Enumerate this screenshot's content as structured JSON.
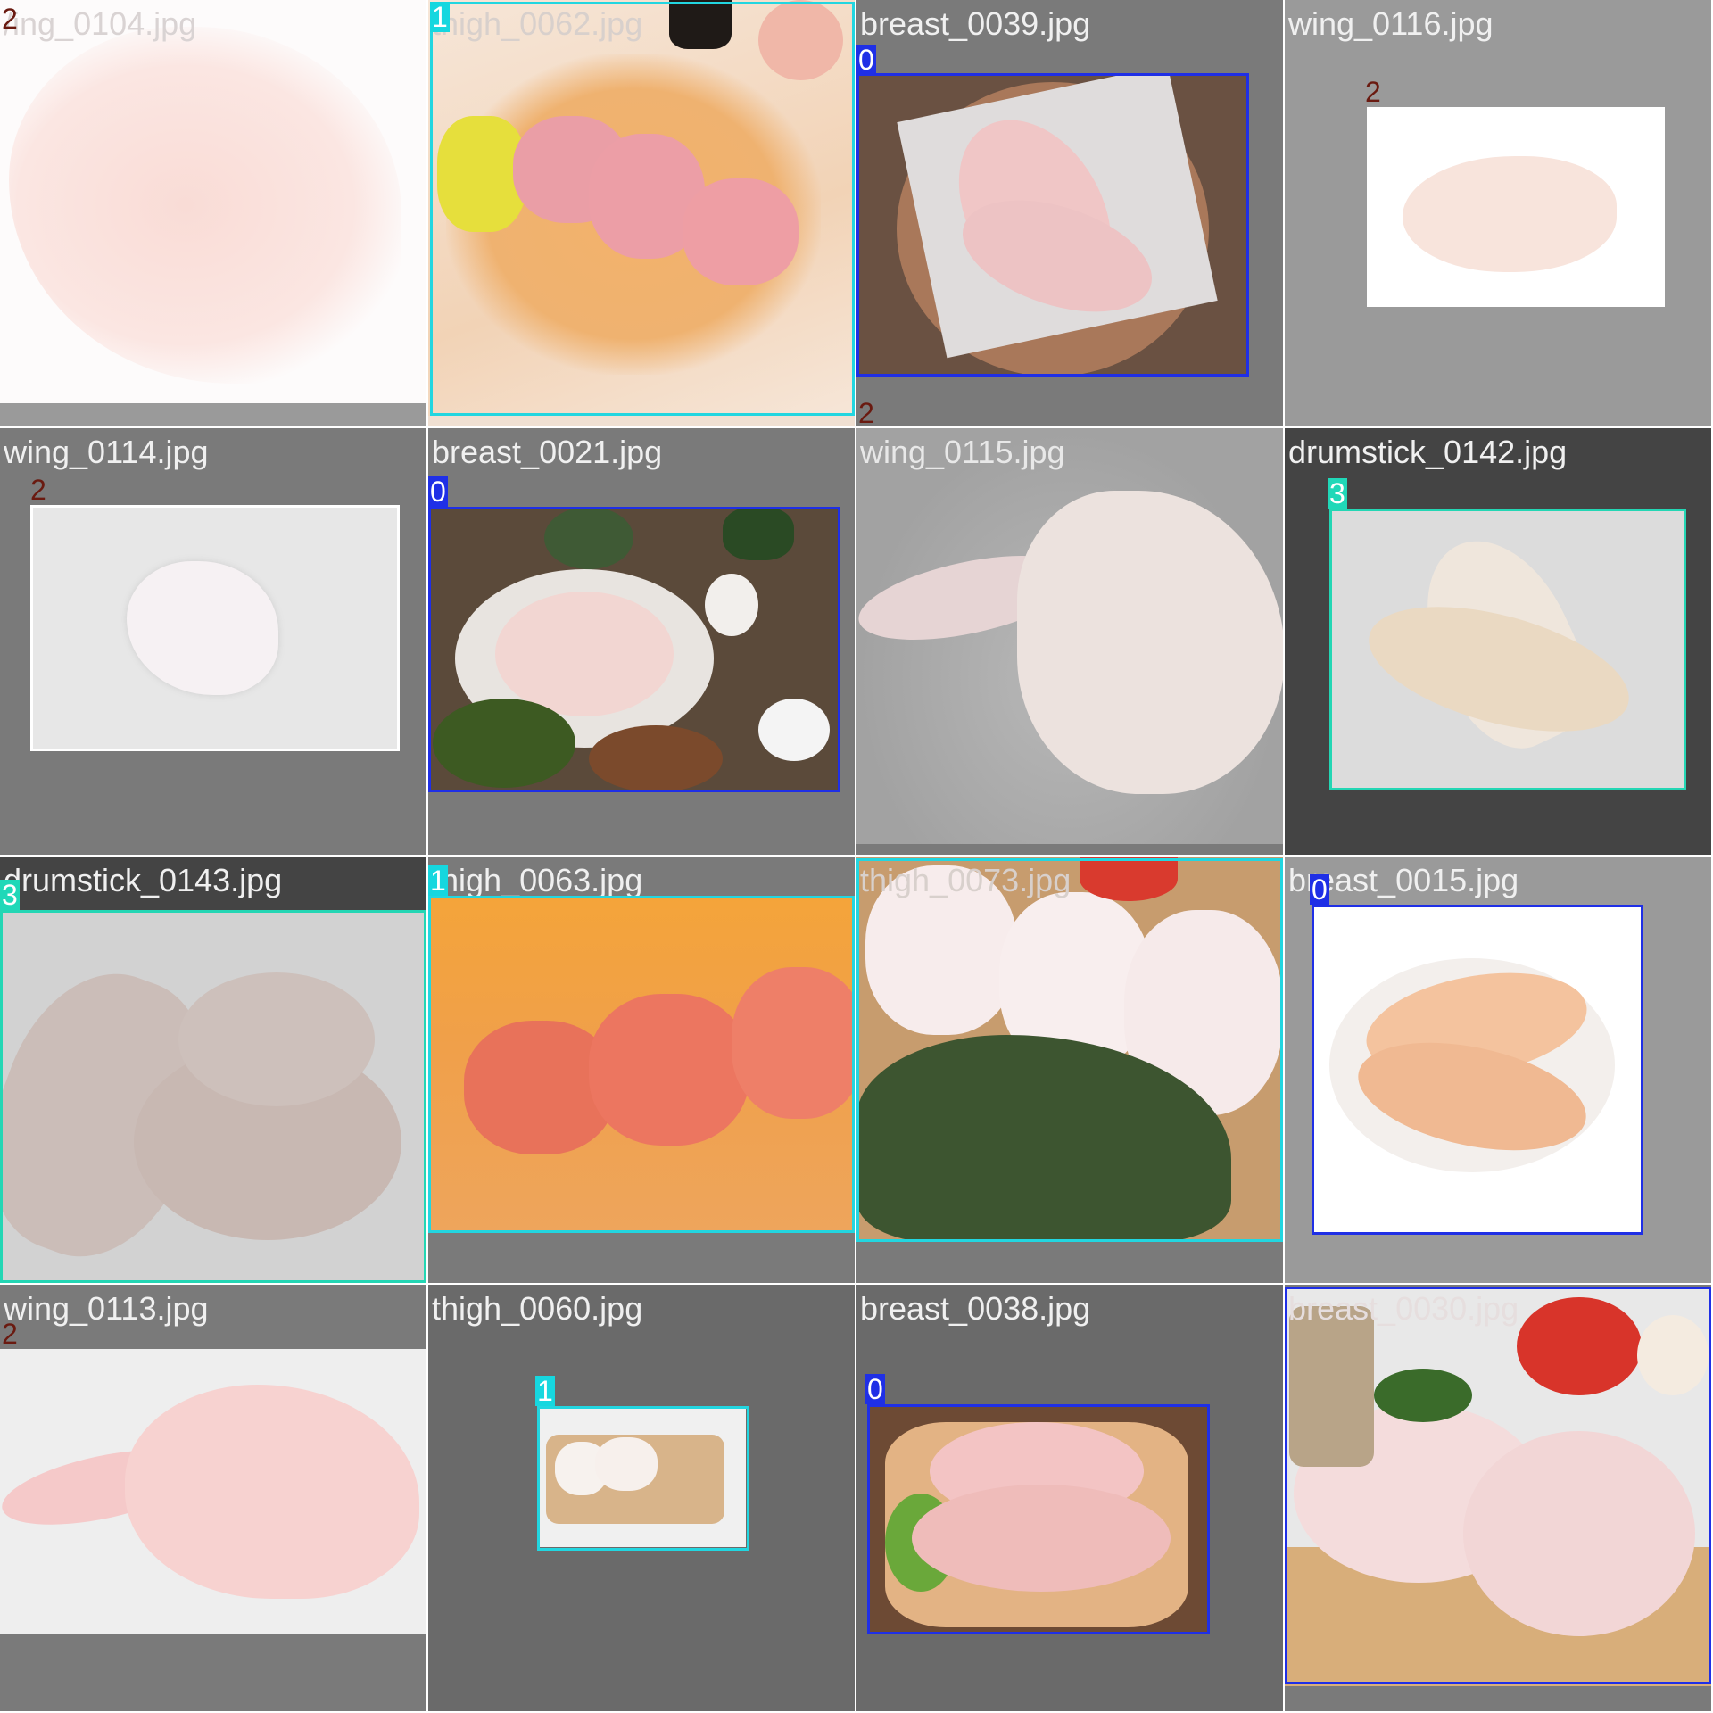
{
  "tiles": [
    {
      "filename": "wing_0104.jpg",
      "display_filename": "/ing_0104.jpg",
      "labels": [
        "2"
      ],
      "box_class": "none"
    },
    {
      "filename": "thigh_0062.jpg",
      "display_filename": "thigh_0062.jpg",
      "labels": [
        "1"
      ],
      "box_class": "1"
    },
    {
      "filename": "breast_0039.jpg",
      "display_filename": "breast_0039.jpg",
      "labels": [
        "0",
        "2"
      ],
      "box_class": "0"
    },
    {
      "filename": "wing_0116.jpg",
      "display_filename": "wing_0116.jpg",
      "labels": [
        "2"
      ],
      "box_class": "2"
    },
    {
      "filename": "wing_0114.jpg",
      "display_filename": "wing_0114.jpg",
      "labels": [
        "2"
      ],
      "box_class": "2"
    },
    {
      "filename": "breast_0021.jpg",
      "display_filename": "breast_0021.jpg",
      "labels": [
        "0"
      ],
      "box_class": "0"
    },
    {
      "filename": "wing_0115.jpg",
      "display_filename": "wing_0115.jpg",
      "labels": [],
      "box_class": "none"
    },
    {
      "filename": "drumstick_0142.jpg",
      "display_filename": "drumstick_0142.jpg",
      "labels": [
        "3"
      ],
      "box_class": "3"
    },
    {
      "filename": "drumstick_0143.jpg",
      "display_filename": "drumstick_0143.jpg",
      "labels": [
        "3"
      ],
      "box_class": "3"
    },
    {
      "filename": "thigh_0063.jpg",
      "display_filename": "thigh_0063.jpg",
      "labels": [
        "1"
      ],
      "box_class": "1"
    },
    {
      "filename": "thigh_0073.jpg",
      "display_filename": "thigh_0073.jpg",
      "labels": [
        "1"
      ],
      "box_class": "1"
    },
    {
      "filename": "breast_0015.jpg",
      "display_filename": "breast_0015.jpg",
      "labels": [
        "0"
      ],
      "box_class": "0"
    },
    {
      "filename": "wing_0113.jpg",
      "display_filename": "wing_0113.jpg",
      "labels": [
        "2"
      ],
      "box_class": "2"
    },
    {
      "filename": "thigh_0060.jpg",
      "display_filename": "thigh_0060.jpg",
      "labels": [
        "1"
      ],
      "box_class": "1"
    },
    {
      "filename": "breast_0038.jpg",
      "display_filename": "breast_0038.jpg",
      "labels": [
        "0"
      ],
      "box_class": "0"
    },
    {
      "filename": "breast_0030.jpg",
      "display_filename": "breast_0030.jpg",
      "labels": [
        "0"
      ],
      "box_class": "0"
    }
  ],
  "class_colors": {
    "0": "#1f2fe6",
    "1": "#16d7df",
    "2": "#6a1a10",
    "3": "#20d8b8"
  }
}
